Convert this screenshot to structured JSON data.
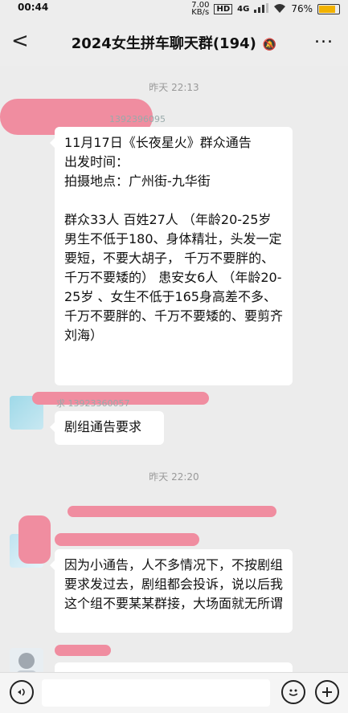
{
  "status": {
    "time": "00:44",
    "speed": "7.00\nKB/s",
    "hd": "HD",
    "network": "4G",
    "battery": "76%"
  },
  "header": {
    "title": "2024女生拼车聊天群(194)",
    "back": "<",
    "more": "...",
    "mute": "🔕"
  },
  "timestamps": [
    "昨天 22:13",
    "昨天 22:20"
  ],
  "messages": [
    {
      "sender": "1392396095",
      "text": "11月17日《长夜星火》群众通告\n出发时间：\n拍摄地点：广州街-九华街\n\n群众33人  百姓27人 （年龄20-25岁 男生不低于180、身体精壮，头发一定要短，不要大胡子， 千万不要胖的、 千万不要矮的）  患安女6人  （年龄20-25岁 、女生不低于165身高差不多、千万不要胖的、千万不要矮的、要剪齐刘海）"
    },
    {
      "sender": "求 13923360057",
      "text": "剧组通告要求"
    },
    {
      "text": "因为小通告，人不多情况下，不按剧组要求发过去，剧组都会投诉，说以后我这个组不要某某群接，大场面就无所谓"
    }
  ],
  "colors": {
    "background": "#ececec",
    "bubble": "#ffffff",
    "redaction": "#f08da0"
  }
}
